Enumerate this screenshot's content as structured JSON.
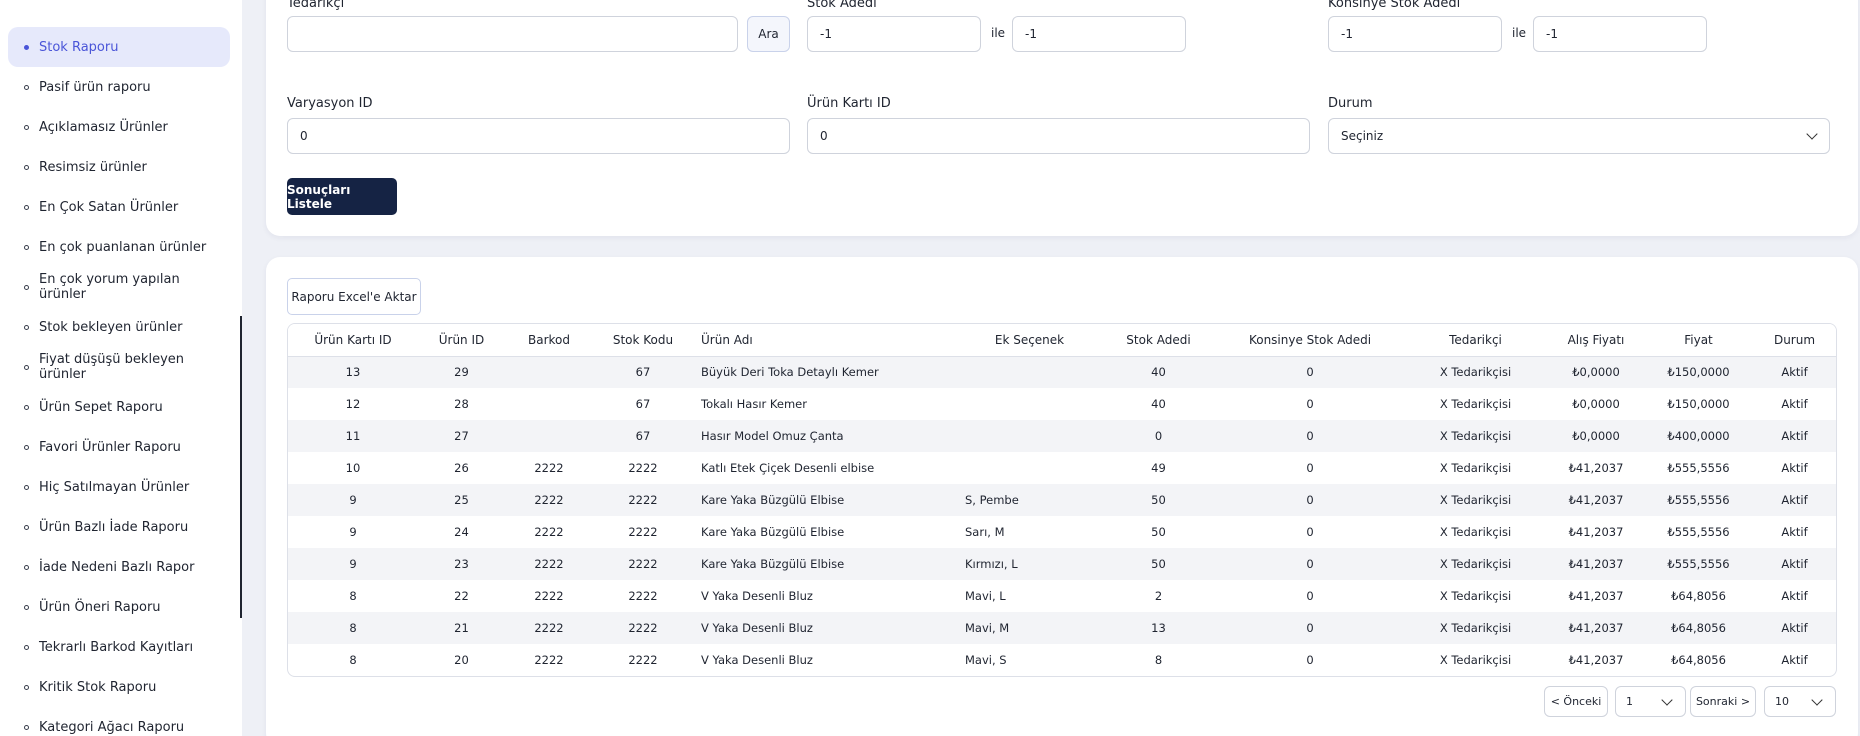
{
  "sidebar": {
    "items": [
      {
        "label": "Stok Raporu",
        "active": true
      },
      {
        "label": "Pasif ürün raporu"
      },
      {
        "label": "Açıklamasız Ürünler"
      },
      {
        "label": "Resimsiz ürünler"
      },
      {
        "label": "En Çok Satan Ürünler"
      },
      {
        "label": "En çok puanlanan ürünler"
      },
      {
        "label": "En çok yorum yapılan ürünler"
      },
      {
        "label": "Stok bekleyen ürünler"
      },
      {
        "label": "Fiyat düşüşü bekleyen ürünler"
      },
      {
        "label": "Ürün Sepet Raporu"
      },
      {
        "label": "Favori Ürünler Raporu"
      },
      {
        "label": "Hiç Satılmayan Ürünler"
      },
      {
        "label": "Ürün Bazlı İade Raporu"
      },
      {
        "label": "İade Nedeni Bazlı Rapor"
      },
      {
        "label": "Ürün Öneri Raporu"
      },
      {
        "label": "Tekrarlı Barkod Kayıtları"
      },
      {
        "label": "Kritik Stok Raporu"
      },
      {
        "label": "Kategori Ağacı Raporu"
      }
    ]
  },
  "filters": {
    "tedarikci_label": "Tedarikçi",
    "tedarikci_value": "",
    "ara_label": "Ara",
    "stok_label": "Stok Adedi",
    "stok_min": "-1",
    "stok_max": "-1",
    "ile": "ile",
    "konsinye_label": "Konsinye Stok Adedi",
    "konsinye_min": "-1",
    "konsinye_max": "-1",
    "varyasyon_label": "Varyasyon ID",
    "varyasyon_value": "0",
    "urun_karti_label": "Ürün Kartı ID",
    "urun_karti_value": "0",
    "durum_label": "Durum",
    "durum_value": "Seçiniz",
    "submit_label": "Sonuçları Listele"
  },
  "report": {
    "excel_label": "Raporu Excel'e Aktar",
    "columns": [
      "Ürün Kartı ID",
      "Ürün ID",
      "Barkod",
      "Stok Kodu",
      "Ürün Adı",
      "Ek Seçenek",
      "Stok Adedi",
      "Konsinye Stok Adedi",
      "Tedarikçi",
      "Alış Fiyatı",
      "Fiyat",
      "Durum"
    ],
    "rows": [
      [
        "13",
        "29",
        "",
        "67",
        "Büyük Deri Toka Detaylı Kemer",
        "",
        "40",
        "0",
        "X Tedarikçisi",
        "₺0,0000",
        "₺150,0000",
        "Aktif"
      ],
      [
        "12",
        "28",
        "",
        "67",
        "Tokalı Hasır Kemer",
        "",
        "40",
        "0",
        "X Tedarikçisi",
        "₺0,0000",
        "₺150,0000",
        "Aktif"
      ],
      [
        "11",
        "27",
        "",
        "67",
        "Hasır Model Omuz Çanta",
        "",
        "0",
        "0",
        "X Tedarikçisi",
        "₺0,0000",
        "₺400,0000",
        "Aktif"
      ],
      [
        "10",
        "26",
        "2222",
        "2222",
        "Katlı Etek Çiçek Desenli elbise",
        "",
        "49",
        "0",
        "X Tedarikçisi",
        "₺41,2037",
        "₺555,5556",
        "Aktif"
      ],
      [
        "9",
        "25",
        "2222",
        "2222",
        "Kare Yaka Büzgülü Elbise",
        "S, Pembe",
        "50",
        "0",
        "X Tedarikçisi",
        "₺41,2037",
        "₺555,5556",
        "Aktif"
      ],
      [
        "9",
        "24",
        "2222",
        "2222",
        "Kare Yaka Büzgülü Elbise",
        "Sarı, M",
        "50",
        "0",
        "X Tedarikçisi",
        "₺41,2037",
        "₺555,5556",
        "Aktif"
      ],
      [
        "9",
        "23",
        "2222",
        "2222",
        "Kare Yaka Büzgülü Elbise",
        "Kırmızı, L",
        "50",
        "0",
        "X Tedarikçisi",
        "₺41,2037",
        "₺555,5556",
        "Aktif"
      ],
      [
        "8",
        "22",
        "2222",
        "2222",
        "V Yaka Desenli Bluz",
        "Mavi, L",
        "2",
        "0",
        "X Tedarikçisi",
        "₺41,2037",
        "₺64,8056",
        "Aktif"
      ],
      [
        "8",
        "21",
        "2222",
        "2222",
        "V Yaka Desenli Bluz",
        "Mavi, M",
        "13",
        "0",
        "X Tedarikçisi",
        "₺41,2037",
        "₺64,8056",
        "Aktif"
      ],
      [
        "8",
        "20",
        "2222",
        "2222",
        "V Yaka Desenli Bluz",
        "Mavi, S",
        "8",
        "0",
        "X Tedarikçisi",
        "₺41,2037",
        "₺64,8056",
        "Aktif"
      ]
    ]
  },
  "pagination": {
    "prev_label": "< Önceki",
    "page_value": "1",
    "next_label": "Sonraki >",
    "page_size_value": "10"
  },
  "colors": {
    "accent": "#4a55d8",
    "primary_button": "#152344",
    "page_bg": "#eef0f6"
  }
}
